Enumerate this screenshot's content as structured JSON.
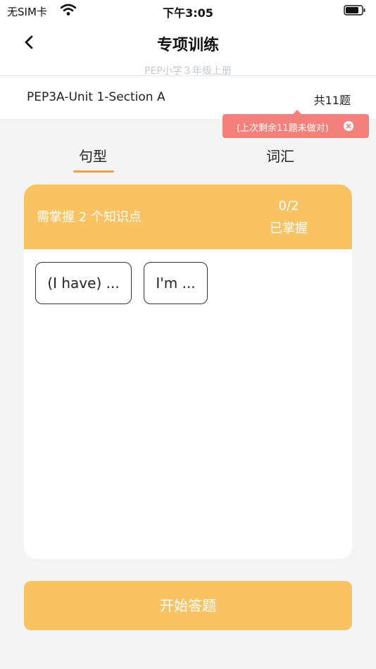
{
  "status_bar": {
    "carrier": "无SIM卡",
    "time": "下午3:05"
  },
  "nav": {
    "title": "专项训练",
    "subtitle": "PEP小学３年级上册"
  },
  "unit": {
    "name": "PEP3A-Unit 1-Section A",
    "count": "共11题"
  },
  "tooltip": {
    "text": "(上次剩余11题未做对)"
  },
  "tabs": [
    {
      "label": "句型",
      "active": true
    },
    {
      "label": "词汇",
      "active": false
    }
  ],
  "card": {
    "header_label": "需掌握 2 个知识点",
    "progress": "0/2",
    "progress_label": "已掌握",
    "chips": [
      "(I have) ...",
      "I'm ..."
    ]
  },
  "start_button": {
    "label": "开始答题"
  },
  "colors": {
    "accent": "#f9c262",
    "tab_underline": "#f0a04a",
    "tooltip": "#f3807a"
  }
}
